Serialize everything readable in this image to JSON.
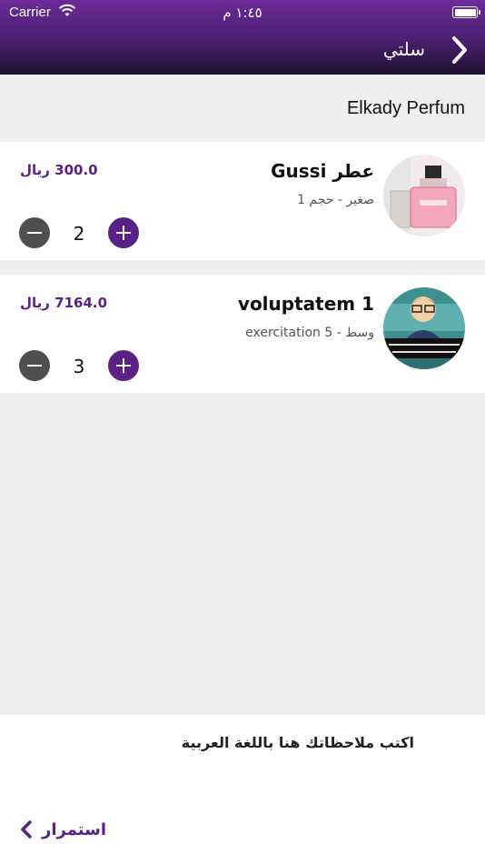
{
  "status_bar": {
    "carrier": "Carrier",
    "time": "١:٤٥ م"
  },
  "nav": {
    "title": "سلتي"
  },
  "store": {
    "name": "Elkady Perfum"
  },
  "items": [
    {
      "name": "عطر Gussi",
      "variant": "صغير - حجم 1",
      "price": "300.0 ريال",
      "quantity": "2",
      "thumb": "perfume-bottle"
    },
    {
      "name": "voluptatem 1",
      "variant": "وسط - exercitation 5",
      "price": "7164.0 ريال",
      "quantity": "3",
      "thumb": "cartoon-businessman"
    }
  ],
  "notes": {
    "placeholder": "اكتب ملاحظاتك هنا باللغة العربية"
  },
  "footer": {
    "continue_label": "استمرار"
  },
  "colors": {
    "accent": "#5b2186",
    "header_top": "#6b2a99",
    "header_bottom": "#1e1030",
    "minus": "#4f4f4f"
  }
}
